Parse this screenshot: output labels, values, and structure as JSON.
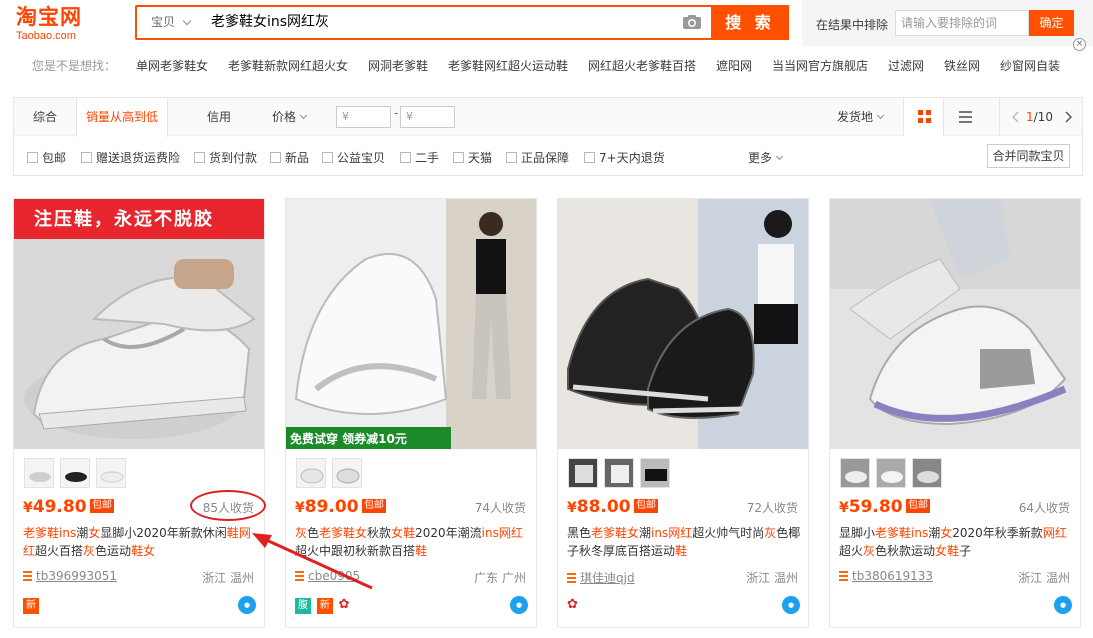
{
  "header": {
    "logo_cn": "淘宝网",
    "logo_en": "Taobao.com",
    "search_type": "宝贝",
    "search_query": "老爹鞋女ins网红灰",
    "search_button": "搜 索",
    "exclude_label": "在结果中排除",
    "exclude_placeholder": "请输入要排除的词",
    "exclude_button": "确定",
    "close": "×"
  },
  "suggest": {
    "label": "您是不是想找：",
    "items": [
      "单网老爹鞋女",
      "老爹鞋新款网红超火女",
      "网洞老爹鞋",
      "老爹鞋网红超火运动鞋",
      "网红超火老爹鞋百搭",
      "遮阳网",
      "当当网官方旗舰店",
      "过滤网",
      "铁丝网",
      "纱窗网自装"
    ]
  },
  "sort": {
    "items": [
      "综合",
      "销量从高到低",
      "信用",
      "价格"
    ],
    "price_from": "¥",
    "price_to": "¥",
    "price_dash": "-",
    "ship_from": "发货地",
    "page_current": "1",
    "page_total": "/10"
  },
  "filters": {
    "checks": [
      "包邮",
      "赠送退货运费险",
      "货到付款",
      "新品",
      "公益宝贝",
      "二手",
      "天猫",
      "正品保障",
      "7+天内退货"
    ],
    "more": "更多",
    "merge": "合并同款宝贝"
  },
  "products": [
    {
      "price": "49.80",
      "currency": "¥",
      "baoyou": "包邮",
      "sales": "85人收货",
      "title_parts": [
        {
          "t": "老爹鞋",
          "hl": true
        },
        {
          "t": "ins",
          "hl": true
        },
        {
          "t": "潮",
          "hl": false
        },
        {
          "t": "女",
          "hl": true
        },
        {
          "t": "显脚小2020年新款休闲",
          "hl": false
        },
        {
          "t": "鞋",
          "hl": true
        },
        {
          "t": "网红",
          "hl": true
        },
        {
          "t": "超火百搭",
          "hl": false
        },
        {
          "t": "灰",
          "hl": true
        },
        {
          "t": "色运动",
          "hl": false
        },
        {
          "t": "鞋女",
          "hl": true
        }
      ],
      "shop": "tb396993051",
      "location": "浙江 温州",
      "tags": [
        "新"
      ],
      "banner": "注压鞋，永远不脱胶"
    },
    {
      "price": "89.00",
      "currency": "¥",
      "baoyou": "包邮",
      "sales": "74人收货",
      "title_parts": [
        {
          "t": "灰",
          "hl": true
        },
        {
          "t": "色",
          "hl": false
        },
        {
          "t": "老爹鞋女",
          "hl": true
        },
        {
          "t": "秋款",
          "hl": false
        },
        {
          "t": "女鞋",
          "hl": true
        },
        {
          "t": "2020年潮流",
          "hl": false
        },
        {
          "t": "ins",
          "hl": true
        },
        {
          "t": "网红",
          "hl": true
        },
        {
          "t": "超火中跟初秋新款百搭",
          "hl": false
        },
        {
          "t": "鞋",
          "hl": true
        }
      ],
      "shop": "cbe0905",
      "location": "广东 广州",
      "tags": [
        "腹",
        "新",
        "rose"
      ],
      "banner": "免费试穿  领券减10元"
    },
    {
      "price": "88.00",
      "currency": "¥",
      "baoyou": "包邮",
      "sales": "72人收货",
      "title_parts": [
        {
          "t": "黑色",
          "hl": false
        },
        {
          "t": "老爹鞋女",
          "hl": true
        },
        {
          "t": "潮",
          "hl": false
        },
        {
          "t": "ins",
          "hl": true
        },
        {
          "t": "网红",
          "hl": true
        },
        {
          "t": "超火帅气时尚",
          "hl": false
        },
        {
          "t": "灰",
          "hl": true
        },
        {
          "t": "色椰子秋冬厚底百搭运动",
          "hl": false
        },
        {
          "t": "鞋",
          "hl": true
        }
      ],
      "shop": "琪佳迪qjd",
      "location": "浙江 温州",
      "tags": [
        "rose"
      ],
      "banner": ""
    },
    {
      "price": "59.80",
      "currency": "¥",
      "baoyou": "包邮",
      "sales": "64人收货",
      "title_parts": [
        {
          "t": "显脚小",
          "hl": false
        },
        {
          "t": "老爹鞋",
          "hl": true
        },
        {
          "t": "ins",
          "hl": true
        },
        {
          "t": "潮",
          "hl": false
        },
        {
          "t": "女",
          "hl": true
        },
        {
          "t": "2020年秋季新款",
          "hl": false
        },
        {
          "t": "网红",
          "hl": true
        },
        {
          "t": "超火",
          "hl": false
        },
        {
          "t": "灰",
          "hl": true
        },
        {
          "t": "色秋款运动",
          "hl": false
        },
        {
          "t": "女鞋",
          "hl": true
        },
        {
          "t": "子",
          "hl": false
        }
      ],
      "shop": "tb380619133",
      "location": "浙江 温州",
      "tags": [],
      "banner": ""
    }
  ],
  "colors": {
    "brand": "#ff5000",
    "price": "#ff4400",
    "annotation": "#e02020"
  }
}
